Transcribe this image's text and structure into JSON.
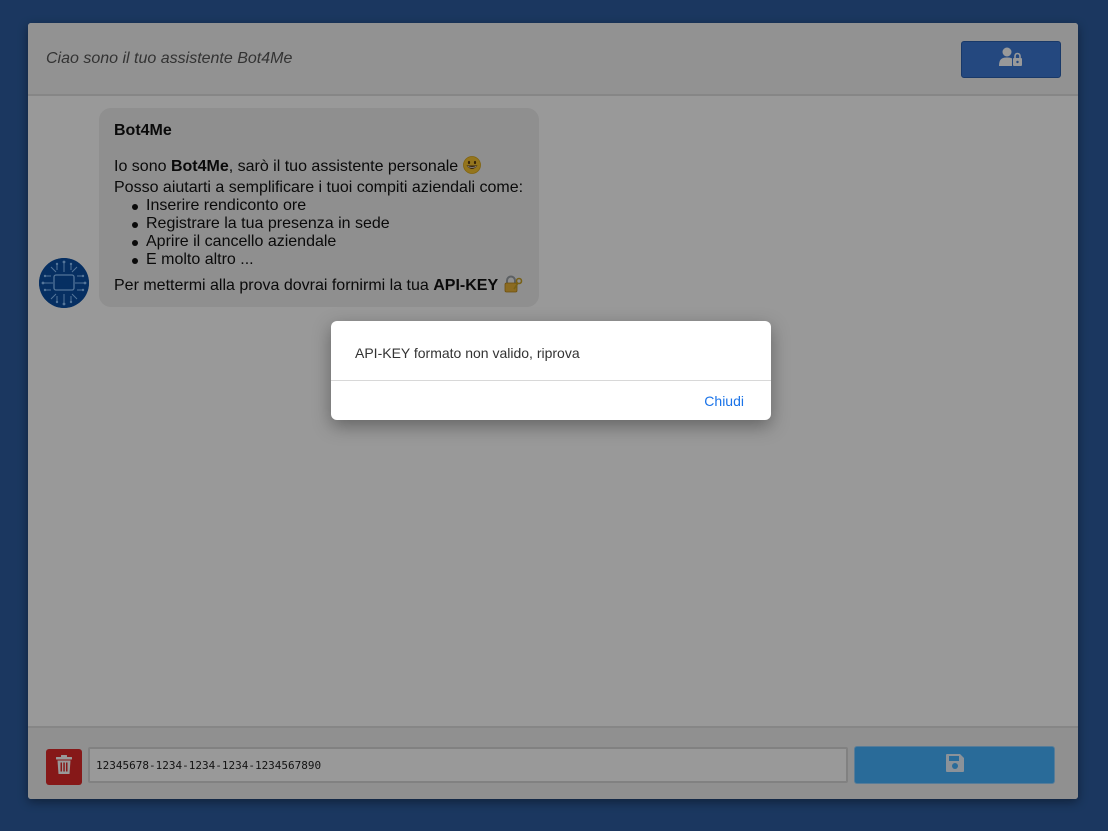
{
  "header": {
    "title": "Ciao sono il tuo assistente Bot4Me",
    "auth_icon": "user-lock-icon"
  },
  "chat": {
    "message": {
      "sender": "Bot4Me",
      "intro_prefix": "Io sono ",
      "intro_name": "Bot4Me",
      "intro_suffix": ", sarò il tuo assistente personale",
      "intro_emoji": "grinning-face-icon",
      "line2": "Posso aiutarti a semplificare i tuoi compiti aziendali come:",
      "items": [
        "Inserire rendiconto ore",
        "Registrare la tua presenza in sede",
        "Aprire il cancello aziendale",
        "E molto altro ..."
      ],
      "closing_prefix": "Per mettermi alla prova dovrai fornirmi la tua ",
      "closing_key": "API-KEY",
      "closing_emoji": "lock-with-key-icon"
    },
    "avatar_icon": "circuit-logo-avatar"
  },
  "footer": {
    "api_key_value": "12345678-1234-1234-1234-1234567890",
    "delete_icon": "trash-icon",
    "save_icon": "floppy-disk-icon"
  },
  "dialog": {
    "message": "API-KEY formato non valido, riprova",
    "close_label": "Chiudi"
  },
  "colors": {
    "background": "#2d5da0",
    "header_button": "#3c79d4",
    "delete_button": "#e02828",
    "save_button": "#45b3ff",
    "link": "#1a73e8"
  }
}
